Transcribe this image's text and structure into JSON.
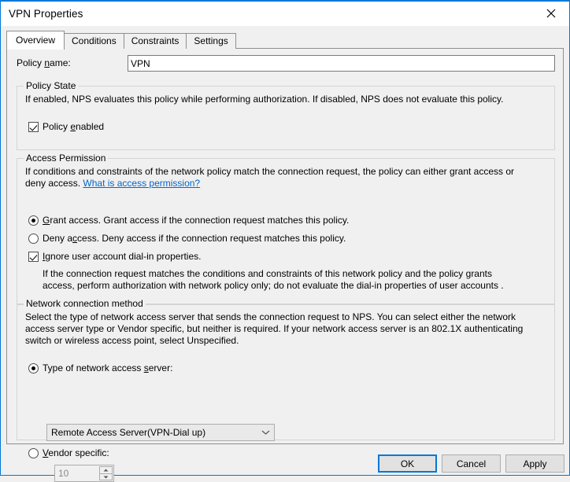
{
  "window": {
    "title": "VPN Properties",
    "close_icon": "close-icon",
    "accent_color": "#0078d7"
  },
  "tabs": [
    {
      "label": "Overview",
      "selected": true
    },
    {
      "label": "Conditions",
      "selected": false
    },
    {
      "label": "Constraints",
      "selected": false
    },
    {
      "label": "Settings",
      "selected": false
    }
  ],
  "policy_name": {
    "label_pre": "Policy ",
    "label_accel": "n",
    "label_post": "ame:",
    "value": "VPN"
  },
  "policy_state": {
    "legend": "Policy State",
    "description": "If enabled, NPS evaluates this policy while performing authorization. If disabled, NPS does not evaluate this policy.",
    "checkbox": {
      "label_pre": "Policy ",
      "label_accel": "e",
      "label_post": "nabled",
      "checked": true
    }
  },
  "access_permission": {
    "legend": "Access Permission",
    "description": "If conditions and constraints of the network policy match the connection request, the policy can either grant access or deny access.",
    "link_text": "What is access permission?",
    "options": [
      {
        "label_pre": "",
        "label_accel": "G",
        "label_post": "rant access. Grant access if the connection request matches this policy.",
        "selected": true
      },
      {
        "label_pre": "Deny a",
        "label_accel": "c",
        "label_post": "cess. Deny access if the connection request matches this policy.",
        "selected": false
      }
    ],
    "ignore_checkbox": {
      "label_pre": "",
      "label_accel": "I",
      "label_post": "gnore user account dial-in properties.",
      "checked": true
    },
    "ignore_description": "If the connection request matches the conditions and constraints of this network policy and the policy grants access, perform authorization with network policy only; do not evaluate the dial-in properties of user accounts ."
  },
  "network_connection_method": {
    "legend": "Network connection method",
    "description": "Select the type of network access server that sends the connection request to NPS. You can select either the network access server type or Vendor specific, but neither is required.  If your network access server is an 802.1X authenticating switch or wireless access point, select Unspecified.",
    "nas_radio": {
      "label_pre": "Type of network access ",
      "label_accel": "s",
      "label_post": "erver:",
      "selected": true
    },
    "nas_combo": {
      "value": "Remote Access Server(VPN-Dial up)",
      "arrow_icon": "chevron-down-icon"
    },
    "vendor_radio": {
      "label_pre": "",
      "label_accel": "V",
      "label_post": "endor specific:",
      "selected": false
    },
    "vendor_spinner": {
      "value": "10",
      "up_icon": "spinner-up-icon",
      "down_icon": "spinner-down-icon"
    }
  },
  "buttons": {
    "ok": "OK",
    "cancel": "Cancel",
    "apply": "Apply"
  }
}
